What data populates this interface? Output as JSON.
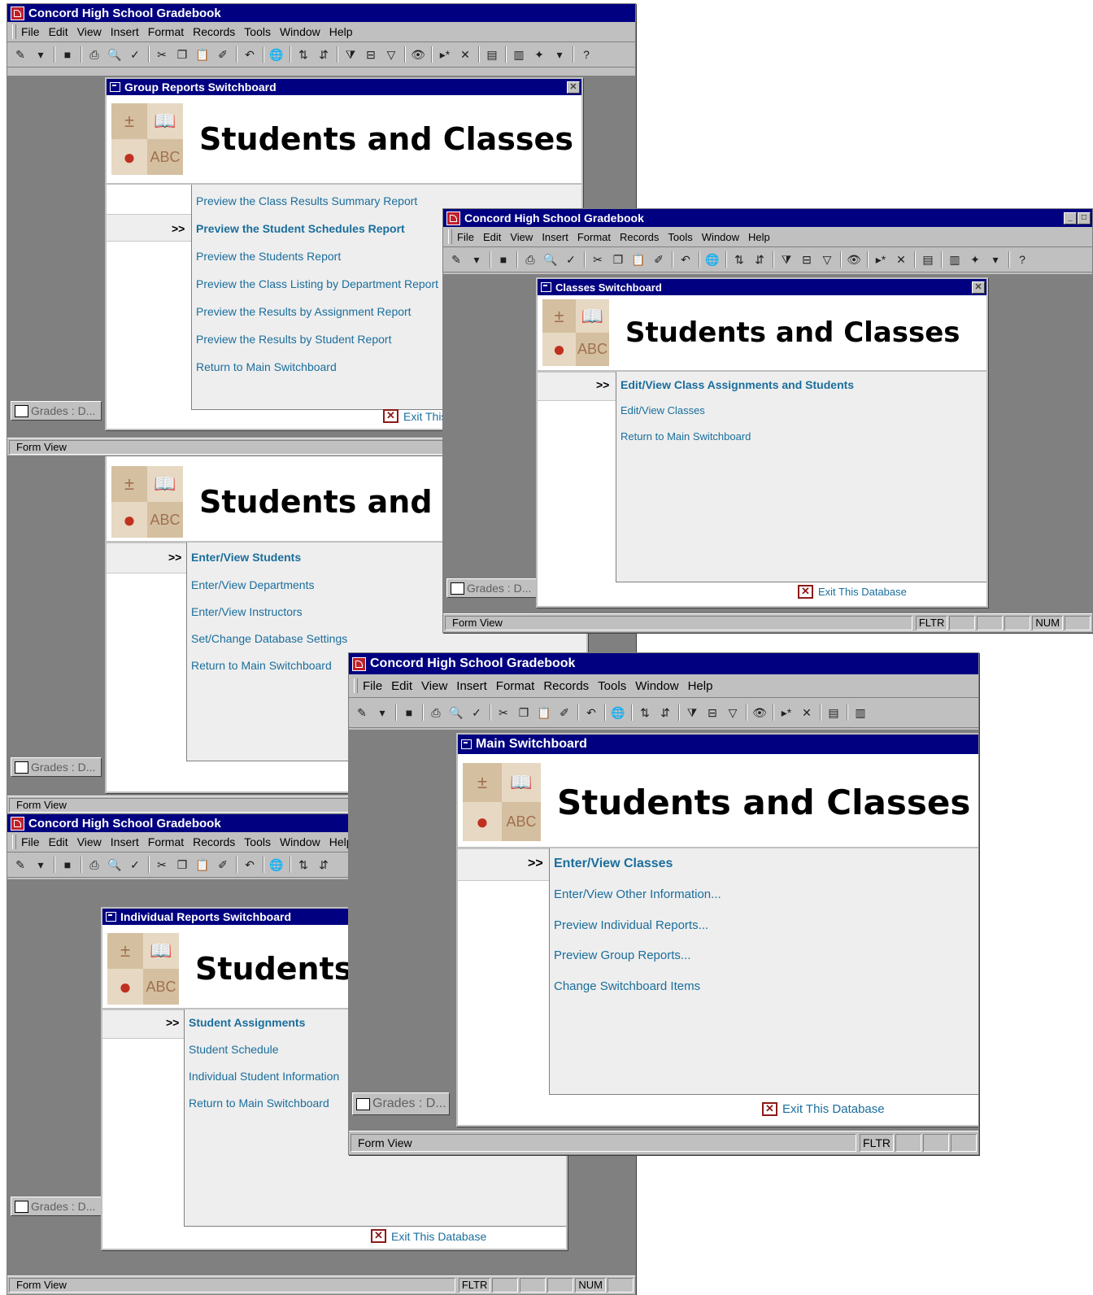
{
  "app": {
    "title": "Concord High School Gradebook",
    "menu": [
      "File",
      "Edit",
      "View",
      "Insert",
      "Format",
      "Records",
      "Tools",
      "Window",
      "Help"
    ],
    "status_mode": "Form View",
    "status_fltr": "FLTR",
    "status_num": "NUM",
    "minimized_label": "Grades : D..."
  },
  "header_title": "Students and Classes",
  "exit_label": "Exit This Database",
  "group": {
    "form_title": "Group Reports Switchboard",
    "selected": "Preview the Student Schedules Report",
    "items": [
      "Preview the Class Results Summary Report",
      "Preview the Student Schedules Report",
      "Preview the Students Report",
      "Preview the Class Listing by Department Report",
      "Preview the Results by Assignment Report",
      "Preview the Results by Student Report",
      "Return to Main Switchboard"
    ],
    "exit_fragment": "Exit This"
  },
  "other": {
    "items": [
      "Enter/View Students",
      "Enter/View Departments",
      "Enter/View Instructors",
      "Set/Change Database Settings",
      "Return to Main Switchboard"
    ],
    "title_fragment": "Students and C"
  },
  "classes": {
    "form_title": "Classes Switchboard",
    "items": [
      "Edit/View Class Assignments and Students",
      "Edit/View Classes",
      "Return to Main Switchboard"
    ]
  },
  "individual": {
    "form_title": "Individual Reports Switchboard",
    "title_fragment": "Students",
    "items": [
      "Student Assignments",
      "Student Schedule",
      "Individual Student Information",
      "Return to Main Switchboard"
    ]
  },
  "main": {
    "form_title": "Main Switchboard",
    "items": [
      "Enter/View Classes",
      "Enter/View Other Information...",
      "Preview Individual Reports...",
      "Preview Group Reports...",
      "Change Switchboard Items"
    ]
  },
  "colors": {
    "titlebar": "#000080",
    "link": "#1a6e9c",
    "panel": "#eeeeee"
  }
}
